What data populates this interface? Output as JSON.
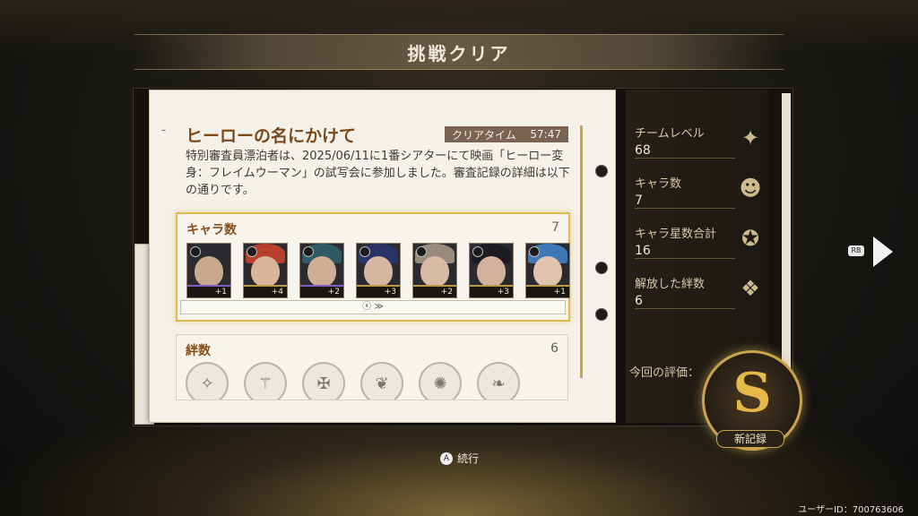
{
  "title": "挑戦クリア",
  "record": {
    "heading": "ヒーローの名にかけて",
    "clear_time_label": "クリアタイム",
    "clear_time_value": "57:47",
    "description": "特別審査員漂泊者は、2025/06/11に1番シアターにて映画「ヒーロー変身：フレイムウーマン」の試写会に参加しました。審査記録の詳細は以下の通りです。"
  },
  "characters_section": {
    "title": "キャラ数",
    "count": "7",
    "characters": [
      {
        "stars": "+1",
        "rarity_color": "#7c5fbf"
      },
      {
        "stars": "+4",
        "rarity_color": "#b89a4a"
      },
      {
        "stars": "+2",
        "rarity_color": "#7c5fbf"
      },
      {
        "stars": "+3",
        "rarity_color": "#b89a4a"
      },
      {
        "stars": "+2",
        "rarity_color": "#b89a4a"
      },
      {
        "stars": "+3",
        "rarity_color": "#b89a4a"
      },
      {
        "stars": "+1",
        "rarity_color": "#b89a4a"
      }
    ],
    "expand_label": "ⓧ ≫"
  },
  "bonds_section": {
    "title": "絆数",
    "count": "6"
  },
  "stats": [
    {
      "label": "チームレベル",
      "value": "68",
      "icon": "sparkle-icon"
    },
    {
      "label": "キャラ数",
      "value": "7",
      "icon": "character-icon"
    },
    {
      "label": "キャラ星数合計",
      "value": "16",
      "icon": "star-total-icon"
    },
    {
      "label": "解放した絆数",
      "value": "6",
      "icon": "bond-icon"
    }
  ],
  "evaluation": {
    "label": "今回の評価：",
    "rank": "S",
    "new_record": "新記録"
  },
  "nav": {
    "rb_label": "RB"
  },
  "continue": {
    "button": "A",
    "label": "続行"
  },
  "user_id": "ユーザーID：700763606"
}
